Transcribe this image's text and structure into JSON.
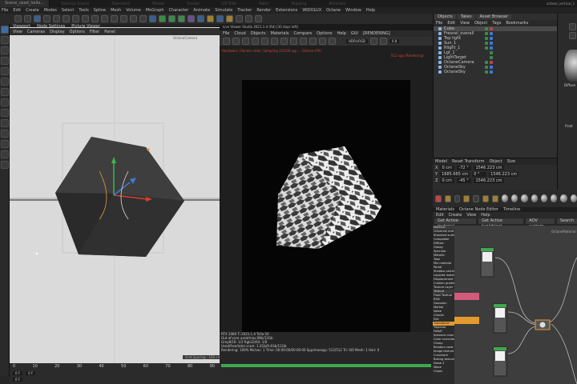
{
  "titlebar": {
    "tab": "Scene_used_hello...",
    "ghost_tabs": [
      "Startup Scene",
      "Standard",
      "Model",
      "Sculpt",
      "UV Edit",
      "Paint",
      "Rigging",
      "Animate",
      "Track",
      "Script",
      "Nodes",
      "Octane"
    ],
    "layout_name": "octane_vertical_1"
  },
  "menubar": [
    "File",
    "Edit",
    "Create",
    "Modes",
    "Select",
    "Tools",
    "Spline",
    "Mesh",
    "Volume",
    "MoGraph",
    "Character",
    "Animate",
    "Simulate",
    "Tracker",
    "Render",
    "Extensions",
    "WIDOLUX",
    "Octane",
    "Window",
    "Help"
  ],
  "viewport": {
    "tabs": [
      "Viewport",
      "Node Settings",
      "Picture Viewer"
    ],
    "menu": [
      "View",
      "Cameras",
      "Display",
      "Options",
      "Filter",
      "Panel"
    ],
    "camera_label": "OctaneCamera",
    "info": "Grid Spacing : 100 cm",
    "timeline": {
      "start": "0 F",
      "end": "0 F",
      "current": "0 F",
      "marks": [
        "0",
        "10",
        "20",
        "30",
        "40",
        "50",
        "60",
        "70",
        "80",
        "90"
      ]
    }
  },
  "picture_viewer": {
    "title": "Live Viewer Studio 2021.1.4 (R4) [30 days left]",
    "menu": [
      "File",
      "Cloud",
      "Objects",
      "Materials",
      "Compare",
      "Options",
      "Help",
      "GUI",
      "[RENDERING]"
    ],
    "mode_dropdown": "HDR/sRGB",
    "zoom": "0.8",
    "status_line": "Hardware / Render stats: Sampling 25/256 spp ... Octane:CPU",
    "render_status": "512 spp (Rendering)",
    "stats": [
      "RTX 2080 Ti 2021.1.4  Tc0a  50",
      "Out-of-core used/max:0Kb/12Gb",
      "Grey8/16: 1/2   Rgb32/64: 1/0",
      "Used/free/total vram: 1.2Gb/9.4Gb/11Gb",
      "Rendering: 100%  Ms/sec: 1  Time: 00:00:00/00:00:00  Spp/maxspp: 512/512  Tri: 0/0  Mesh: 1  Hair: 0"
    ],
    "progress": 1.0
  },
  "objects": {
    "tabs": [
      "Objects",
      "Takes",
      "Asset Browser"
    ],
    "menu": [
      "File",
      "Edit",
      "View",
      "Object",
      "Tags",
      "Bookmarks"
    ],
    "items": [
      {
        "name": "Cube",
        "selected": true
      },
      {
        "name": "Fresnel_overall",
        "selected": false
      },
      {
        "name": "Top light",
        "selected": false
      },
      {
        "name": "Sun_1",
        "selected": false
      },
      {
        "name": "Rlight_1",
        "selected": false
      },
      {
        "name": "Lgt_1",
        "selected": false
      },
      {
        "name": "LightTarget",
        "selected": false
      },
      {
        "name": "OctaneCamera",
        "selected": false
      },
      {
        "name": "OctaneSky",
        "selected": false
      },
      {
        "name": "OctaneSky",
        "selected": false
      }
    ]
  },
  "attributes": {
    "header": [
      "Model",
      "Reset Transform",
      "Object",
      "Size"
    ],
    "rows": [
      {
        "axis": "X",
        "pos": "0 cm",
        "rot": "-72 °",
        "size": "1546.223 cm"
      },
      {
        "axis": "Y",
        "pos": "1685.665 cm",
        "rot": "0 °",
        "size": "1546.223 cm"
      },
      {
        "axis": "Z",
        "pos": "0 cm",
        "rot": "-45 °",
        "size": "1546.223 cm"
      }
    ]
  },
  "node_editor": {
    "tabs": [
      "Materials",
      "Octane Node Editor",
      "Timeline"
    ],
    "menu": [
      "Edit",
      "Create",
      "View",
      "Help"
    ],
    "buttons": [
      "Get Active material",
      "Get Active tag/object",
      "AOV system",
      "Search"
    ],
    "list": [
      "Material",
      "Universal mat",
      "Standard surface",
      "Composite",
      "Diffuse",
      "Glossy",
      "Specular",
      "Metallic",
      "Toon",
      "Mix material",
      "Portal",
      "Shadow catcher",
      "Layered material",
      "Displacement",
      "Custom gradient",
      "Texture Layer",
      "Texture",
      "Float Texture",
      "RGB",
      "Gaussian",
      "Marble",
      "Noise",
      "Checks",
      "Dirt",
      "Turbulence",
      "Triplanar",
      "Falloff",
      "Instance color",
      "Color correction",
      "Clamp",
      "Random color",
      "Image texture",
      "Curvature",
      "Baking texture",
      "Noise 2",
      "Wave",
      "Chaos"
    ],
    "graph_label": "OctaneMaterial",
    "dropdown": "All"
  },
  "right_panel": {
    "label": "Diffuse",
    "extra": "Float"
  },
  "colors": {
    "accent_blue": "#3b7bd6",
    "render_green": "#3ea84c",
    "node_orange": "#e29a2e",
    "node_pink": "#d25a7a",
    "status_red": "#c84b2a"
  }
}
